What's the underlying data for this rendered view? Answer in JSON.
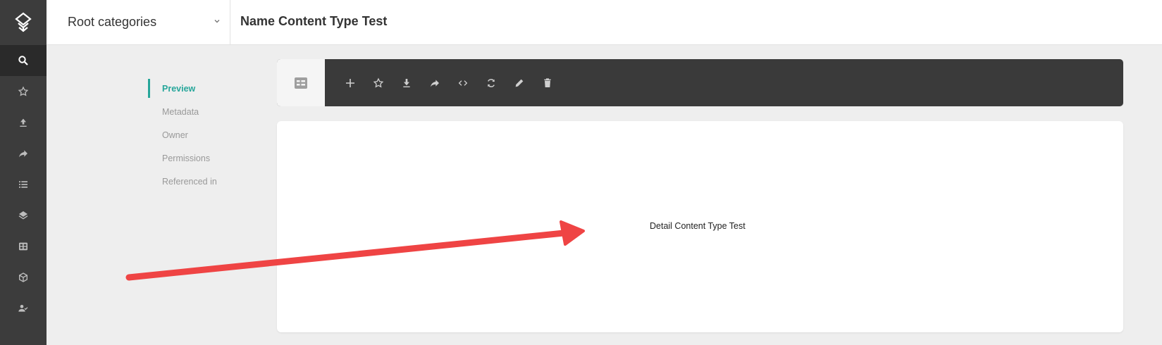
{
  "header": {
    "category_select": {
      "label": "Root categories"
    },
    "title": "Name Content Type Test"
  },
  "rail": {
    "logo_icon": "app-logo-icon",
    "items": [
      {
        "icon": "search-icon",
        "active": true
      },
      {
        "icon": "star-icon",
        "active": false
      },
      {
        "icon": "upload-icon",
        "active": false
      },
      {
        "icon": "share-icon",
        "active": false
      },
      {
        "icon": "list-icon",
        "active": false
      },
      {
        "icon": "layers-icon",
        "active": false
      },
      {
        "icon": "table-icon",
        "active": false
      },
      {
        "icon": "cube-icon",
        "active": false
      },
      {
        "icon": "user-check-icon",
        "active": false
      }
    ]
  },
  "side_tabs": [
    {
      "label": "Preview",
      "active": true
    },
    {
      "label": "Metadata",
      "active": false
    },
    {
      "label": "Owner",
      "active": false
    },
    {
      "label": "Permissions",
      "active": false
    },
    {
      "label": "Referenced in",
      "active": false
    }
  ],
  "toolbar": {
    "view_toggle_icon": "list-view-icon",
    "actions": [
      "add-icon",
      "star-icon",
      "download-icon",
      "share-icon",
      "code-icon",
      "refresh-icon",
      "edit-icon",
      "delete-icon"
    ]
  },
  "preview": {
    "content_text": "Detail Content Type Test"
  },
  "colors": {
    "rail_bg": "#3c3c3c",
    "accent": "#26a69a",
    "toolbar_bg": "#3a3a3a",
    "annotation_arrow": "#ef4444"
  }
}
